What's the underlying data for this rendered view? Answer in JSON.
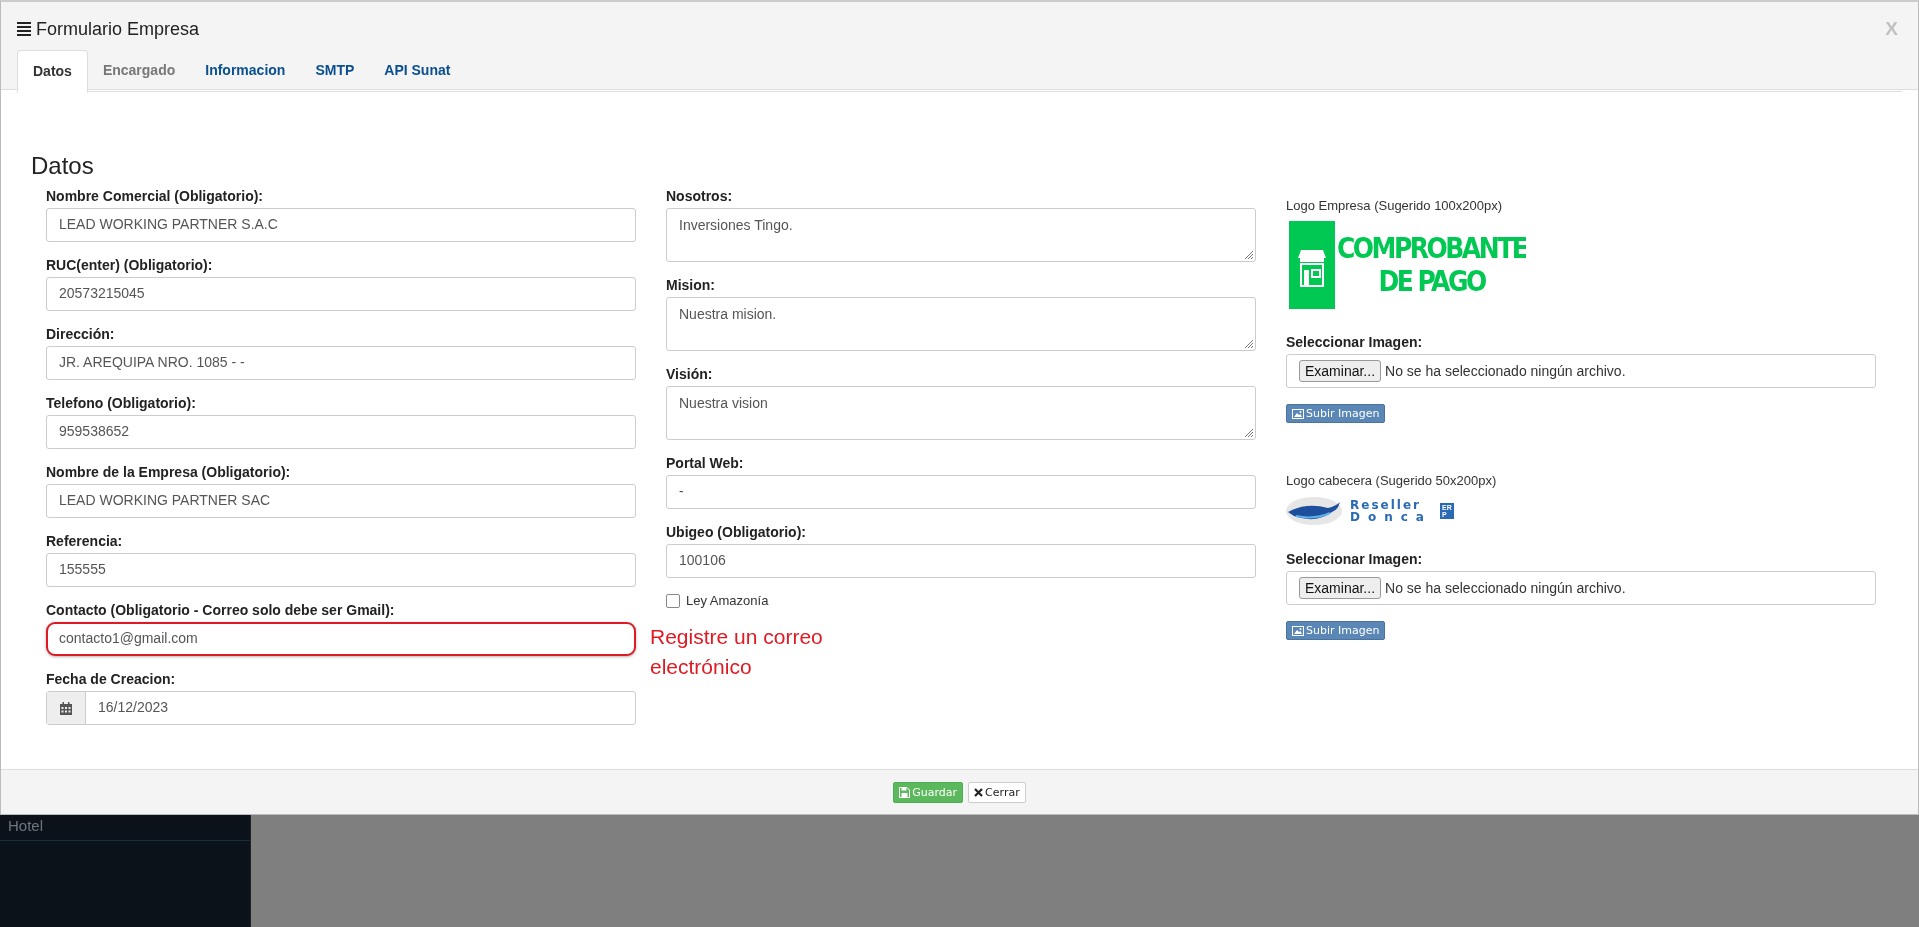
{
  "modal": {
    "title": "Formulario Empresa",
    "close": "X",
    "tabs": [
      {
        "label": "Datos",
        "selected": true,
        "disabled": false
      },
      {
        "label": "Encargado",
        "selected": false,
        "disabled": true
      },
      {
        "label": "Informacion",
        "selected": false,
        "disabled": false
      },
      {
        "label": "SMTP",
        "selected": false,
        "disabled": false
      },
      {
        "label": "API Sunat",
        "selected": false,
        "disabled": false
      }
    ],
    "section_title": "Datos",
    "left_fields": [
      {
        "kind": "text",
        "label": "Nombre Comercial (Obligatorio):",
        "value": "LEAD WORKING PARTNER S.A.C"
      },
      {
        "kind": "text",
        "label": "RUC(enter) (Obligatorio):",
        "value": "20573215045"
      },
      {
        "kind": "text",
        "label": "Dirección:",
        "value": "JR. AREQUIPA NRO. 1085 - -"
      },
      {
        "kind": "text",
        "label": "Telefono (Obligatorio):",
        "value": "959538652"
      },
      {
        "kind": "text",
        "label": "Nombre de la Empresa (Obligatorio):",
        "value": "LEAD WORKING PARTNER SAC"
      },
      {
        "kind": "text",
        "label": "Referencia:",
        "value": "155555"
      },
      {
        "kind": "text",
        "label": "Contacto (Obligatorio - Correo solo debe ser Gmail):",
        "value": "contacto1@gmail.com",
        "error": "Registre un correo electrónico"
      },
      {
        "kind": "date",
        "label": "Fecha de Creacion:",
        "value": "16/12/2023"
      }
    ],
    "middle_fields": [
      {
        "kind": "textarea",
        "label": "Nosotros:",
        "value": "Inversiones Tingo."
      },
      {
        "kind": "textarea",
        "label": "Mision:",
        "value": "Nuestra mision."
      },
      {
        "kind": "textarea",
        "label": "Visión:",
        "value": "Nuestra vision"
      },
      {
        "kind": "text",
        "label": "Portal Web:",
        "value": "-"
      },
      {
        "kind": "text",
        "label": "Ubigeo (Obligatorio):",
        "value": "100106"
      },
      {
        "kind": "checkbox",
        "label": "Ley Amazonía",
        "checked": false
      }
    ],
    "logos": [
      {
        "kind": "comprobante",
        "label": "Logo Empresa (Sugerido 100x200px)",
        "logo_text": [
          "COMPROBANTE",
          "DE PAGO"
        ],
        "select_label": "Seleccionar Imagen:",
        "browse": "Examinar...",
        "file_status": "No se ha seleccionado ningún archivo.",
        "upload": "Subir Imagen"
      },
      {
        "kind": "reseller",
        "label": "Logo cabecera (Sugerido 50x200px)",
        "logo_text": [
          "Reseller",
          "Donca",
          "ERP"
        ],
        "select_label": "Seleccionar Imagen:",
        "browse": "Examinar...",
        "file_status": "No se ha seleccionado ningún archivo.",
        "upload": "Subir Imagen"
      }
    ],
    "footer_buttons": [
      {
        "kind": "save",
        "label": "Guardar"
      },
      {
        "kind": "close",
        "label": "Cerrar"
      }
    ]
  },
  "background": {
    "sidebar_item": "Hotel"
  }
}
